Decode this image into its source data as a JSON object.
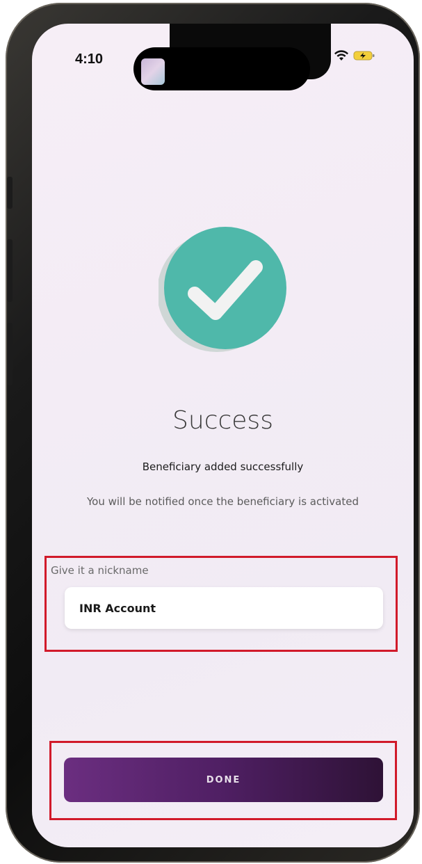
{
  "status_bar": {
    "time": "4:10"
  },
  "success": {
    "title": "Success",
    "subtitle": "Beneficiary added successfully",
    "note": "You will be notified once the beneficiary is activated"
  },
  "nickname": {
    "label": "Give it a nickname",
    "value": "INR Account"
  },
  "actions": {
    "done_label": "DONE"
  },
  "colors": {
    "accent": "#5a2570",
    "success": "#4fb8aa",
    "highlight": "#d11a2a"
  }
}
